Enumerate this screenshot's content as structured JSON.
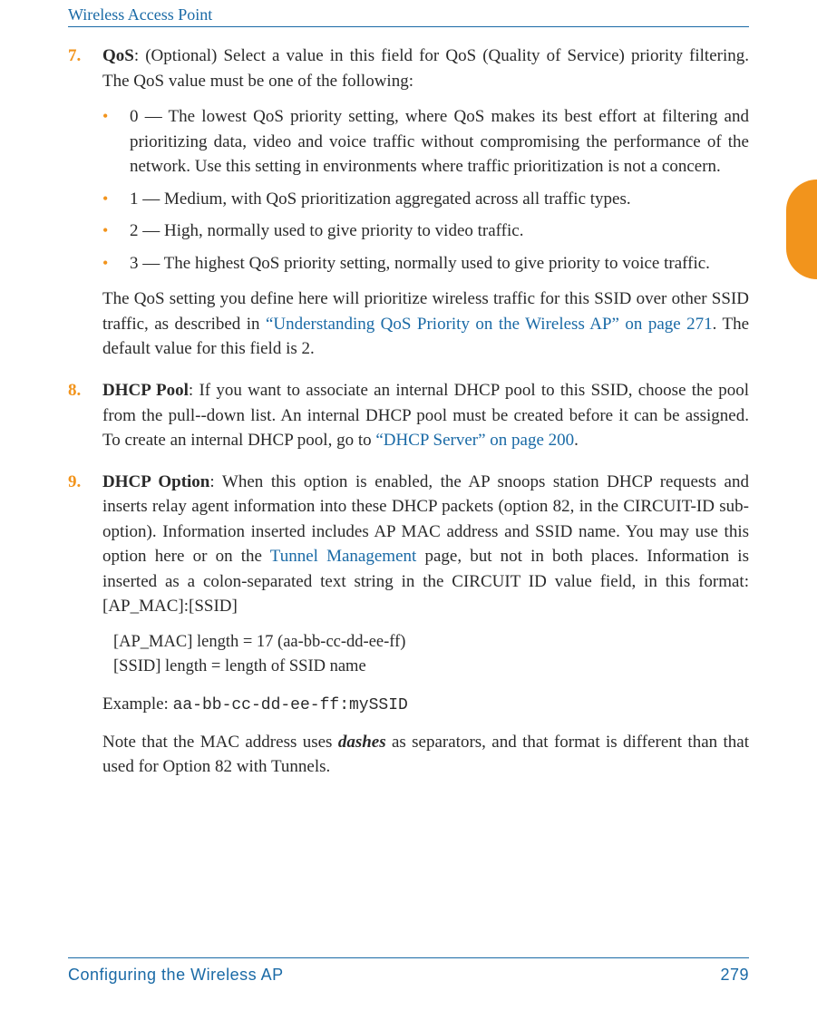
{
  "header": {
    "title": "Wireless Access Point"
  },
  "side_tab": {
    "color": "#f2941c"
  },
  "footer": {
    "left": "Configuring the Wireless AP",
    "right": "279"
  },
  "items": [
    {
      "num": "7.",
      "title": "QoS",
      "lead": ": (Optional) Select a value in this field for QoS (Quality of Service) priority filtering. The QoS value must be one of the following:",
      "bullets": [
        "0 — The lowest QoS priority setting, where QoS makes its best effort at filtering and prioritizing data, video and voice traffic without compromising the performance of the network. Use this setting in environments where traffic prioritization is not a concern.",
        "1 — Medium, with QoS prioritization aggregated across all traffic types.",
        "2 — High, normally used to give priority to video traffic.",
        "3 — The highest QoS priority setting, normally used to give priority to voice traffic."
      ],
      "trail_pre": "The QoS setting you define here will prioritize wireless traffic for this SSID over other SSID traffic, as described in ",
      "trail_link": "“Understanding QoS Priority on the Wireless AP” on page 271",
      "trail_post": ". The default value for this field is 2."
    },
    {
      "num": "8.",
      "title": "DHCP Pool",
      "lead_pre": ": If you want to associate an internal DHCP pool to this SSID, choose the pool from the pull--down list. An internal DHCP pool must be created before it can be assigned. To create an internal DHCP pool, go to ",
      "lead_link": "“DHCP Server” on page 200",
      "lead_post": "."
    },
    {
      "num": "9.",
      "title": "DHCP Option",
      "lead_pre": ": When this option is enabled, the AP snoops station DHCP requests and inserts relay agent information into these DHCP packets (option 82, in the CIRCUIT-ID sub-option). Information inserted includes AP MAC address and SSID name. You may use this option here or on the ",
      "lead_link": "Tunnel Management",
      "lead_post": " page, but not in both places. Information is inserted as a colon-separated text string in the CIRCUIT ID value field, in this format: [AP_MAC]:[SSID]",
      "block_line1": "[AP_MAC]  length = 17 (aa-bb-cc-dd-ee-ff)",
      "block_line2": "[SSID]    length = length of SSID name",
      "example_label": "Example: ",
      "example_code": "aa-bb-cc-dd-ee-ff:mySSID",
      "note_pre": "Note that the MAC address uses ",
      "note_em": "dashes",
      "note_post": " as separators, and that format is different than that used for Option 82 with Tunnels."
    }
  ]
}
